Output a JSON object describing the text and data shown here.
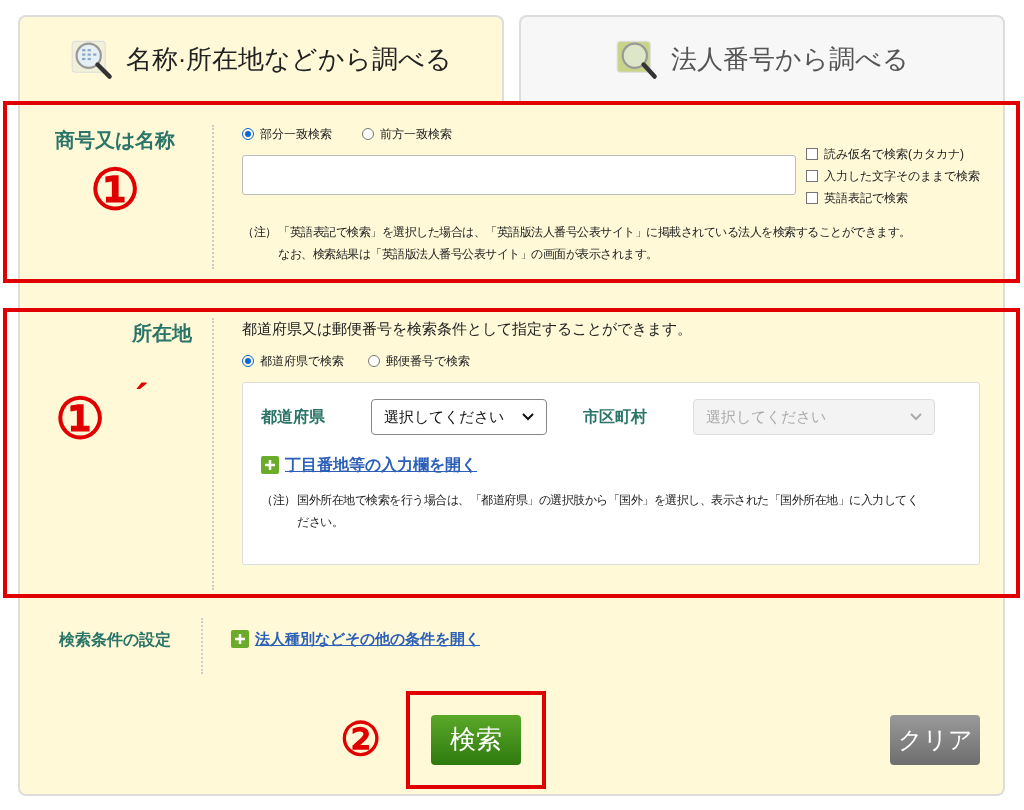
{
  "tabs": [
    {
      "label": "名称·所在地などから調べる",
      "selected": true,
      "kind": "name"
    },
    {
      "label": "法人番号から調べる",
      "selected": false,
      "kind": "number"
    }
  ],
  "name_section": {
    "label": "商号又は名称",
    "annotation": "①",
    "radios": [
      {
        "label": "部分一致検索",
        "selected": true
      },
      {
        "label": "前方一致検索",
        "selected": false
      }
    ],
    "options": [
      {
        "label": "読み仮名で検索(カタカナ)",
        "checked": false
      },
      {
        "label": "入力した文字そのままで検索",
        "checked": false
      },
      {
        "label": "英語表記で検索",
        "checked": false
      }
    ],
    "note": {
      "prefix": "（注）",
      "lines": [
        "「英語表記で検索」を選択した場合は、「英語版法人番号公表サイト」に掲載されている法人を検索することができます。",
        "なお、検索結果は「英語版法人番号公表サイト」の画面が表示されます。"
      ]
    }
  },
  "location_section": {
    "label": "所在地",
    "annotation": "①",
    "annotation_mark": "´",
    "description": "都道府県又は郵便番号を検索条件として指定することができます。",
    "radios": [
      {
        "label": "都道府県で検索",
        "selected": true
      },
      {
        "label": "郵便番号で検索",
        "selected": false
      }
    ],
    "selects": [
      {
        "label": "都道府県",
        "value": "選択してください",
        "disabled": false
      },
      {
        "label": "市区町村",
        "value": "選択してください",
        "disabled": true
      }
    ],
    "expand_link": "丁目番地等の入力欄を開く",
    "note": {
      "prefix": "（注）",
      "lines": [
        "国外所在地で検索を行う場合は、「都道府県」の選択肢から「国外」を選択し、表示された「国外所在地」に入力してく",
        "ださい。"
      ]
    }
  },
  "settings_section": {
    "label": "検索条件の設定",
    "link": "法人種別などその他の条件を開く"
  },
  "buttons": {
    "annotation": "②",
    "search": "検索",
    "clear": "クリア"
  }
}
